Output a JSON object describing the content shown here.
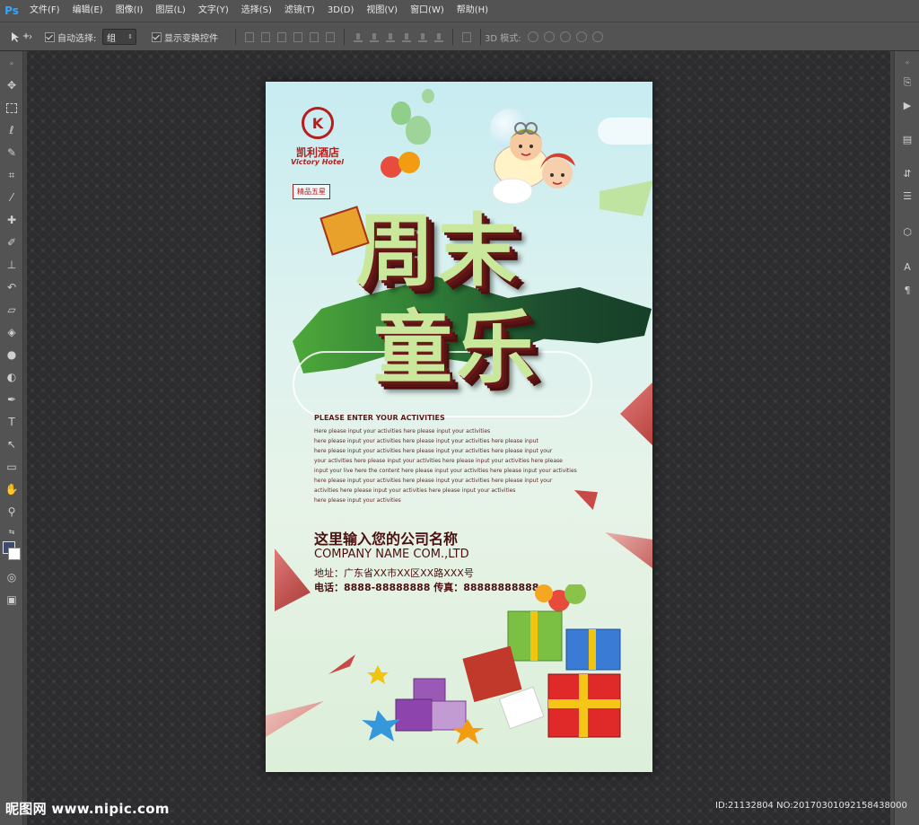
{
  "app": {
    "logo": "Ps"
  },
  "menu": [
    "文件(F)",
    "编辑(E)",
    "图像(I)",
    "图层(L)",
    "文字(Y)",
    "选择(S)",
    "滤镜(T)",
    "3D(D)",
    "视图(V)",
    "窗口(W)",
    "帮助(H)"
  ],
  "options": {
    "auto_select_label": "自动选择:",
    "auto_select_checked": true,
    "auto_select_value": "组",
    "show_transform_label": "显示变换控件",
    "show_transform_checked": true,
    "mode_3d_label": "3D 模式:"
  },
  "colors": {
    "menubar": "#535353",
    "ps_accent": "#31a8ff",
    "poster_title": "#c9e89c",
    "poster_dark": "#5a1414"
  },
  "poster": {
    "hotel_name_cn": "凯利酒店",
    "hotel_name_en": "Victory Hotel",
    "logo_letter": "K",
    "badge": "精品五星",
    "title_line1": "周末",
    "title_line2": "童乐",
    "activities_heading": "PLEASE ENTER YOUR ACTIVITIES",
    "body_lines": [
      "Here please input your activities here please input your activities",
      "here please input your activities here please input your activities here please input",
      "here please input your activities here please input your activities here please input your",
      "your activities here please input your activities here please input your activities here please",
      "input your live here the content here please input your activities here please input your activities",
      "here please input your activities here please input your activities here please input your",
      "activities here please input your activities here please input your activities",
      "here please input your activities"
    ],
    "company_cn": "这里输入您的公司名称",
    "company_en": "COMPANY NAME COM.,LTD",
    "address": "地址：广东省XX市XX区XX路XXX号",
    "phone_line": "电话：8888-88888888  传真：88888888888"
  },
  "watermark": {
    "left": "昵图网 www.nipic.com",
    "right": "ID:21132804 NO:20170301092158438000"
  }
}
